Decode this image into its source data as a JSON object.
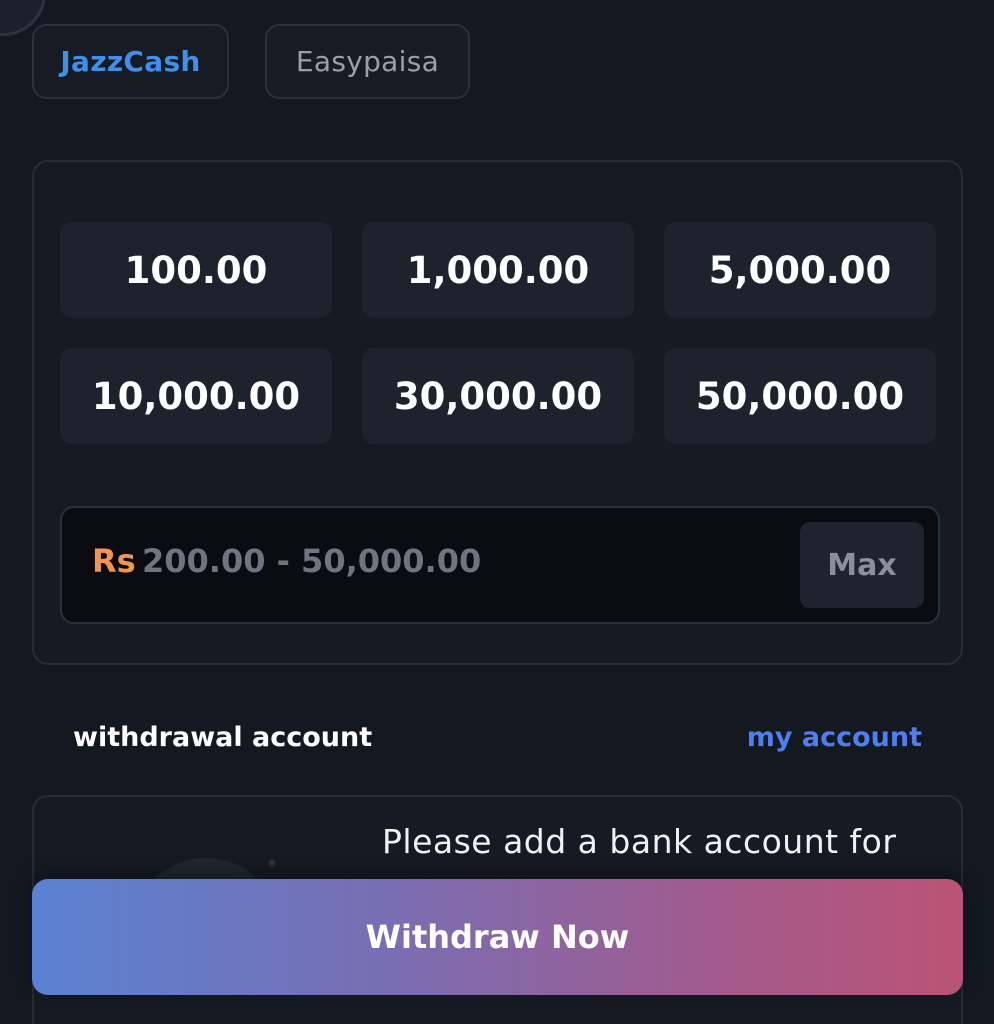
{
  "payment_methods": [
    {
      "label": "JazzCash",
      "selected": true
    },
    {
      "label": "Easypaisa",
      "selected": false
    }
  ],
  "amount_options": [
    "100.00",
    "1,000.00",
    "5,000.00",
    "10,000.00",
    "30,000.00",
    "50,000.00"
  ],
  "amount_input": {
    "currency": "Rs",
    "placeholder": "200.00 - 50,000.00",
    "max_label": "Max"
  },
  "withdrawal_section": {
    "label": "withdrawal account",
    "link_label": "my account",
    "empty_message": "Please add a bank account for"
  },
  "withdraw_button": {
    "label": "Withdraw Now"
  },
  "colors": {
    "background": "#141821",
    "selected_tab_text": "#3f8fec",
    "currency": "#f3964b",
    "link": "#4e7ff0",
    "button_gradient_start": "#5a82d2",
    "button_gradient_end": "#bb5474"
  }
}
